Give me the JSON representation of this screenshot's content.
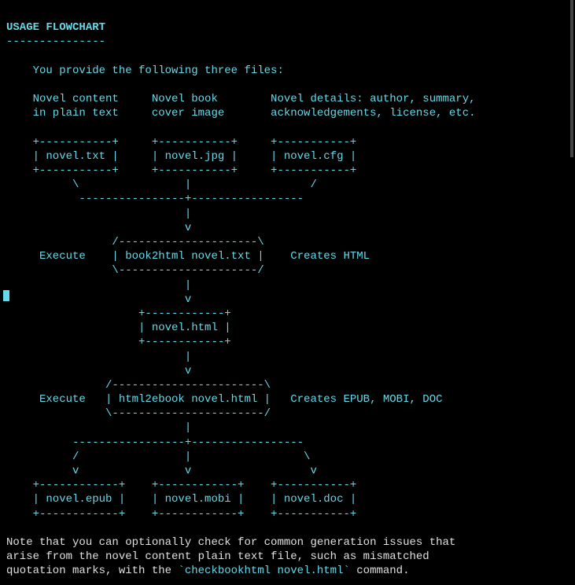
{
  "title": "USAGE FLOWCHART",
  "separator": "---------------",
  "intro": "    You provide the following three files:",
  "desc_line1": "    Novel content     Novel book        Novel details: author, summary,",
  "desc_line2": "    in plain text     cover image       acknowledgements, license, etc.",
  "diag": {
    "l01": "    +-----------+     +-----------+     +-----------+",
    "l02": "    | novel.txt |     | novel.jpg |     | novel.cfg |",
    "l03": "    +-----------+     +-----------+     +-----------+",
    "l04": "          \\                |                  /",
    "l05": "           ----------------+-----------------",
    "l06": "                           |",
    "l07": "                           v",
    "l08": "                /---------------------\\",
    "l09": "     Execute    | book2html novel.txt |    Creates HTML",
    "l10": "                \\---------------------/",
    "l11": "                           |",
    "l12": "                           v",
    "l13": "                    +------------+",
    "l14": "                    | novel.html |",
    "l15": "                    +------------+",
    "l16": "                           |",
    "l17": "                           v",
    "l18": "               /-----------------------\\",
    "l19": "     Execute   | html2ebook novel.html |   Creates EPUB, MOBI, DOC",
    "l20": "               \\-----------------------/",
    "l21": "                           |",
    "l22": "          -----------------+-----------------",
    "l23": "          /                |                 \\",
    "l24": "          v                v                  v",
    "l25": "    +------------+    +------------+    +-----------+",
    "l26": "    | novel.epub |    | novel.mobi |    | novel.doc |",
    "l27": "    +------------+    +------------+    +-----------+"
  },
  "note_1": "Note that you can optionally check for common generation issues that",
  "note_2": "arise from the novel content plain text file, such as mismatched",
  "note_3a": "quotation marks, with the ",
  "note_3b": "`checkbookhtml novel.html`",
  "note_3c": " command."
}
